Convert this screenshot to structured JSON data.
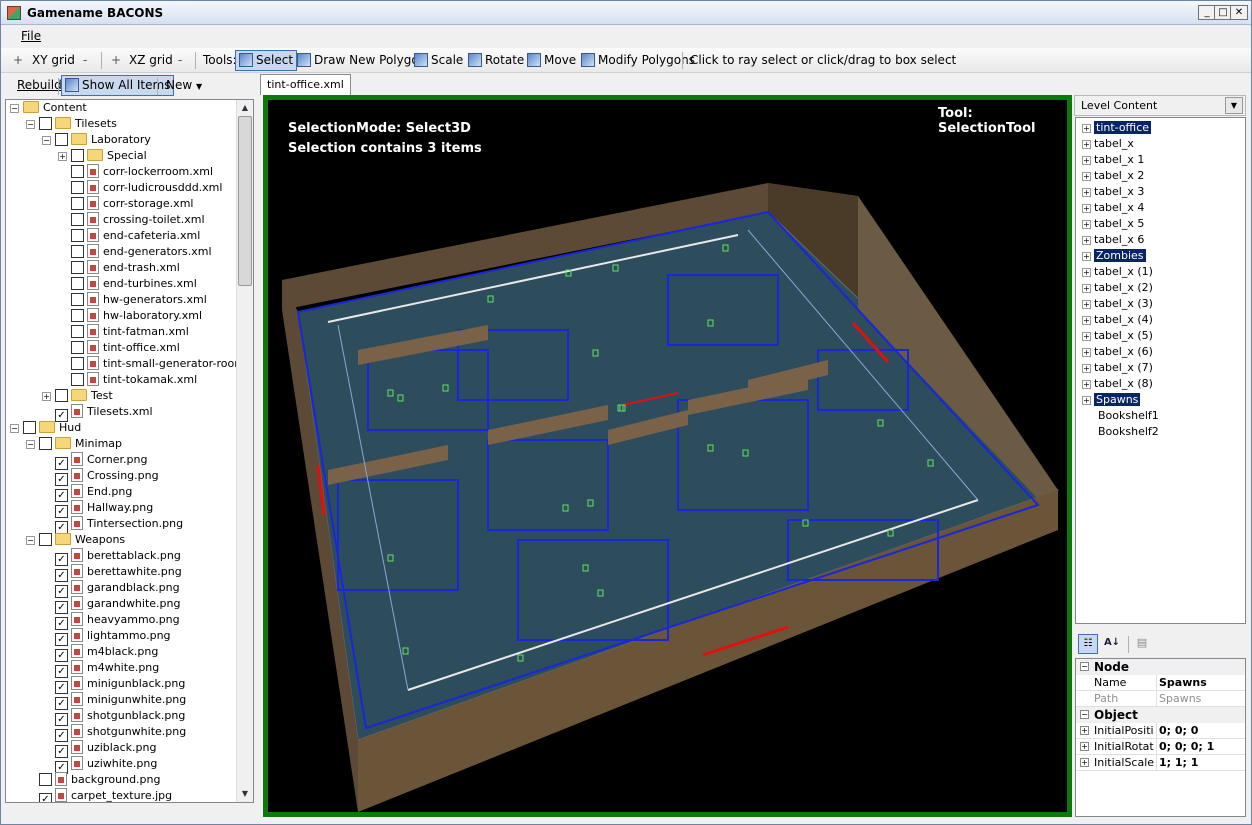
{
  "window": {
    "title": "Gamename BACONS"
  },
  "menu": {
    "file": "File"
  },
  "toolbar": {
    "xy_plus": "+",
    "xy_grid": "XY grid",
    "xy_minus": "-",
    "xz_plus": "+",
    "xz_grid": "XZ grid",
    "xz_minus": "-",
    "tools_label": "Tools:",
    "select": "Select",
    "draw_polygon": "Draw New Polygon",
    "scale": "Scale",
    "rotate": "Rotate",
    "move": "Move",
    "modify_polygons": "Modify Polygons",
    "hint": "Click to ray select or click/drag to box select"
  },
  "left_toolbar": {
    "rebuild": "Rebuild",
    "show_all": "Show All Items",
    "new": "New"
  },
  "content_tree": [
    {
      "d": 0,
      "exp": "-",
      "cb": null,
      "type": "folder",
      "label": "Content"
    },
    {
      "d": 1,
      "exp": "-",
      "cb": false,
      "type": "folder",
      "label": "Tilesets"
    },
    {
      "d": 2,
      "exp": "-",
      "cb": false,
      "type": "folder",
      "label": "Laboratory"
    },
    {
      "d": 3,
      "exp": "+",
      "cb": false,
      "type": "folder",
      "label": "Special"
    },
    {
      "d": 3,
      "exp": null,
      "cb": false,
      "type": "file",
      "label": "corr-lockerroom.xml"
    },
    {
      "d": 3,
      "exp": null,
      "cb": false,
      "type": "file",
      "label": "corr-ludicrousddd.xml"
    },
    {
      "d": 3,
      "exp": null,
      "cb": false,
      "type": "file",
      "label": "corr-storage.xml"
    },
    {
      "d": 3,
      "exp": null,
      "cb": false,
      "type": "file",
      "label": "crossing-toilet.xml"
    },
    {
      "d": 3,
      "exp": null,
      "cb": false,
      "type": "file",
      "label": "end-cafeteria.xml"
    },
    {
      "d": 3,
      "exp": null,
      "cb": false,
      "type": "file",
      "label": "end-generators.xml"
    },
    {
      "d": 3,
      "exp": null,
      "cb": false,
      "type": "file",
      "label": "end-trash.xml"
    },
    {
      "d": 3,
      "exp": null,
      "cb": false,
      "type": "file",
      "label": "end-turbines.xml"
    },
    {
      "d": 3,
      "exp": null,
      "cb": false,
      "type": "file",
      "label": "hw-generators.xml"
    },
    {
      "d": 3,
      "exp": null,
      "cb": false,
      "type": "file",
      "label": "hw-laboratory.xml"
    },
    {
      "d": 3,
      "exp": null,
      "cb": false,
      "type": "file",
      "label": "tint-fatman.xml"
    },
    {
      "d": 3,
      "exp": null,
      "cb": false,
      "type": "file",
      "label": "tint-office.xml"
    },
    {
      "d": 3,
      "exp": null,
      "cb": false,
      "type": "file",
      "label": "tint-small-generator-room.xml"
    },
    {
      "d": 3,
      "exp": null,
      "cb": false,
      "type": "file",
      "label": "tint-tokamak.xml"
    },
    {
      "d": 2,
      "exp": "+",
      "cb": false,
      "type": "folder",
      "label": "Test"
    },
    {
      "d": 2,
      "exp": null,
      "cb": true,
      "type": "file",
      "label": "Tilesets.xml"
    },
    {
      "d": 0,
      "exp": "-",
      "cb": false,
      "type": "folder",
      "label": "Hud"
    },
    {
      "d": 1,
      "exp": "-",
      "cb": false,
      "type": "folder",
      "label": "Minimap"
    },
    {
      "d": 2,
      "exp": null,
      "cb": true,
      "type": "file",
      "label": "Corner.png"
    },
    {
      "d": 2,
      "exp": null,
      "cb": true,
      "type": "file",
      "label": "Crossing.png"
    },
    {
      "d": 2,
      "exp": null,
      "cb": true,
      "type": "file",
      "label": "End.png"
    },
    {
      "d": 2,
      "exp": null,
      "cb": true,
      "type": "file",
      "label": "Hallway.png"
    },
    {
      "d": 2,
      "exp": null,
      "cb": true,
      "type": "file",
      "label": "Tintersection.png"
    },
    {
      "d": 1,
      "exp": "-",
      "cb": false,
      "type": "folder",
      "label": "Weapons"
    },
    {
      "d": 2,
      "exp": null,
      "cb": true,
      "type": "file",
      "label": "berettablack.png"
    },
    {
      "d": 2,
      "exp": null,
      "cb": true,
      "type": "file",
      "label": "berettawhite.png"
    },
    {
      "d": 2,
      "exp": null,
      "cb": true,
      "type": "file",
      "label": "garandblack.png"
    },
    {
      "d": 2,
      "exp": null,
      "cb": true,
      "type": "file",
      "label": "garandwhite.png"
    },
    {
      "d": 2,
      "exp": null,
      "cb": true,
      "type": "file",
      "label": "heavyammo.png"
    },
    {
      "d": 2,
      "exp": null,
      "cb": true,
      "type": "file",
      "label": "lightammo.png"
    },
    {
      "d": 2,
      "exp": null,
      "cb": true,
      "type": "file",
      "label": "m4black.png"
    },
    {
      "d": 2,
      "exp": null,
      "cb": true,
      "type": "file",
      "label": "m4white.png"
    },
    {
      "d": 2,
      "exp": null,
      "cb": true,
      "type": "file",
      "label": "minigunblack.png"
    },
    {
      "d": 2,
      "exp": null,
      "cb": true,
      "type": "file",
      "label": "minigunwhite.png"
    },
    {
      "d": 2,
      "exp": null,
      "cb": true,
      "type": "file",
      "label": "shotgunblack.png"
    },
    {
      "d": 2,
      "exp": null,
      "cb": true,
      "type": "file",
      "label": "shotgunwhite.png"
    },
    {
      "d": 2,
      "exp": null,
      "cb": true,
      "type": "file",
      "label": "uziblack.png"
    },
    {
      "d": 2,
      "exp": null,
      "cb": true,
      "type": "file",
      "label": "uziwhite.png"
    },
    {
      "d": 1,
      "exp": null,
      "cb": false,
      "type": "file",
      "label": "background.png"
    },
    {
      "d": 1,
      "exp": null,
      "cb": true,
      "type": "file",
      "label": "carpet_texture.jpg"
    }
  ],
  "doc_tab": "tint-office.xml",
  "viewport": {
    "mode": "SelectionMode: Select3D",
    "selection": "Selection contains 3 items",
    "tool": "Tool: SelectionTool",
    "border_color": "#0b7a0b"
  },
  "level_content": {
    "header": "Level Content",
    "items": [
      {
        "label": "tint-office",
        "exp": true,
        "hl": true
      },
      {
        "label": "tabel_x",
        "exp": true,
        "hl": false
      },
      {
        "label": "tabel_x 1",
        "exp": true,
        "hl": false
      },
      {
        "label": "tabel_x 2",
        "exp": true,
        "hl": false
      },
      {
        "label": "tabel_x 3",
        "exp": true,
        "hl": false
      },
      {
        "label": "tabel_x 4",
        "exp": true,
        "hl": false
      },
      {
        "label": "tabel_x 5",
        "exp": true,
        "hl": false
      },
      {
        "label": "tabel_x 6",
        "exp": true,
        "hl": false
      },
      {
        "label": "Zombies",
        "exp": true,
        "hl": true
      },
      {
        "label": "tabel_x (1)",
        "exp": true,
        "hl": false
      },
      {
        "label": "tabel_x (2)",
        "exp": true,
        "hl": false
      },
      {
        "label": "tabel_x (3)",
        "exp": true,
        "hl": false
      },
      {
        "label": "tabel_x (4)",
        "exp": true,
        "hl": false
      },
      {
        "label": "tabel_x (5)",
        "exp": true,
        "hl": false
      },
      {
        "label": "tabel_x (6)",
        "exp": true,
        "hl": false
      },
      {
        "label": "tabel_x (7)",
        "exp": true,
        "hl": false
      },
      {
        "label": "tabel_x (8)",
        "exp": true,
        "hl": false
      },
      {
        "label": "Spawns",
        "exp": true,
        "hl": true
      },
      {
        "label": "Bookshelf1",
        "exp": false,
        "hl": false
      },
      {
        "label": "Bookshelf2",
        "exp": false,
        "hl": false
      }
    ]
  },
  "properties": {
    "node_cat": "Node",
    "name_label": "Name",
    "name_value": "Spawns",
    "path_label": "Path",
    "path_value": "Spawns",
    "object_cat": "Object",
    "pos_label": "InitialPosition",
    "pos_value": "0; 0; 0",
    "rot_label": "InitialRotation",
    "rot_value": "0; 0; 0; 1",
    "scale_label": "InitialScale",
    "scale_value": "1; 1; 1"
  }
}
